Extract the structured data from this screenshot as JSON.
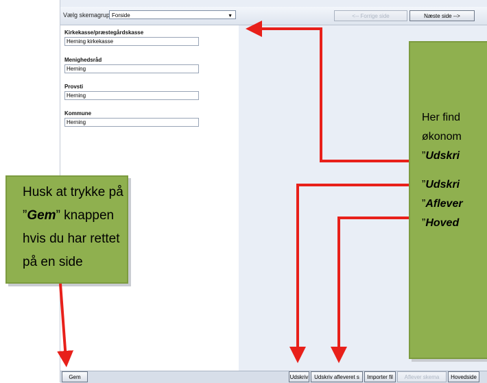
{
  "toolbar": {
    "group_label": "Vælg skemagruppe",
    "group_value": "Forside",
    "prev_label": "<-- Forrige side",
    "next_label": "Næste side -->"
  },
  "form": {
    "fields": [
      {
        "label": "Kirkekasse/præstegårdskasse",
        "value": "Herning kirkekasse"
      },
      {
        "label": "Menighedsråd",
        "value": "Herning"
      },
      {
        "label": "Provsti",
        "value": "Herning"
      },
      {
        "label": "Kommune",
        "value": "Herning"
      }
    ]
  },
  "bottom": {
    "save_label": "Gem",
    "print_label": "Udskriv",
    "print_submitted_label": "Udskriv afleveret s",
    "import_label": "Importer fil",
    "submit_label": "Aflever skema",
    "home_label": "Hovedside"
  },
  "callout_left": {
    "line1": "Husk at trykke på",
    "q1": "”",
    "word1": "Gem",
    "line2_rest": "” knappen",
    "line3": "hvis du har rettet",
    "line4": "på en side"
  },
  "callout_right": {
    "line1": "Her find",
    "line2": "økonom",
    "q": "”",
    "item1": "Udskri",
    "item2": "Udskri",
    "item3": "Aflever",
    "item4": "Hoved"
  },
  "colors": {
    "callout_fill": "#8fb04f",
    "arrow": "#e8201a"
  }
}
